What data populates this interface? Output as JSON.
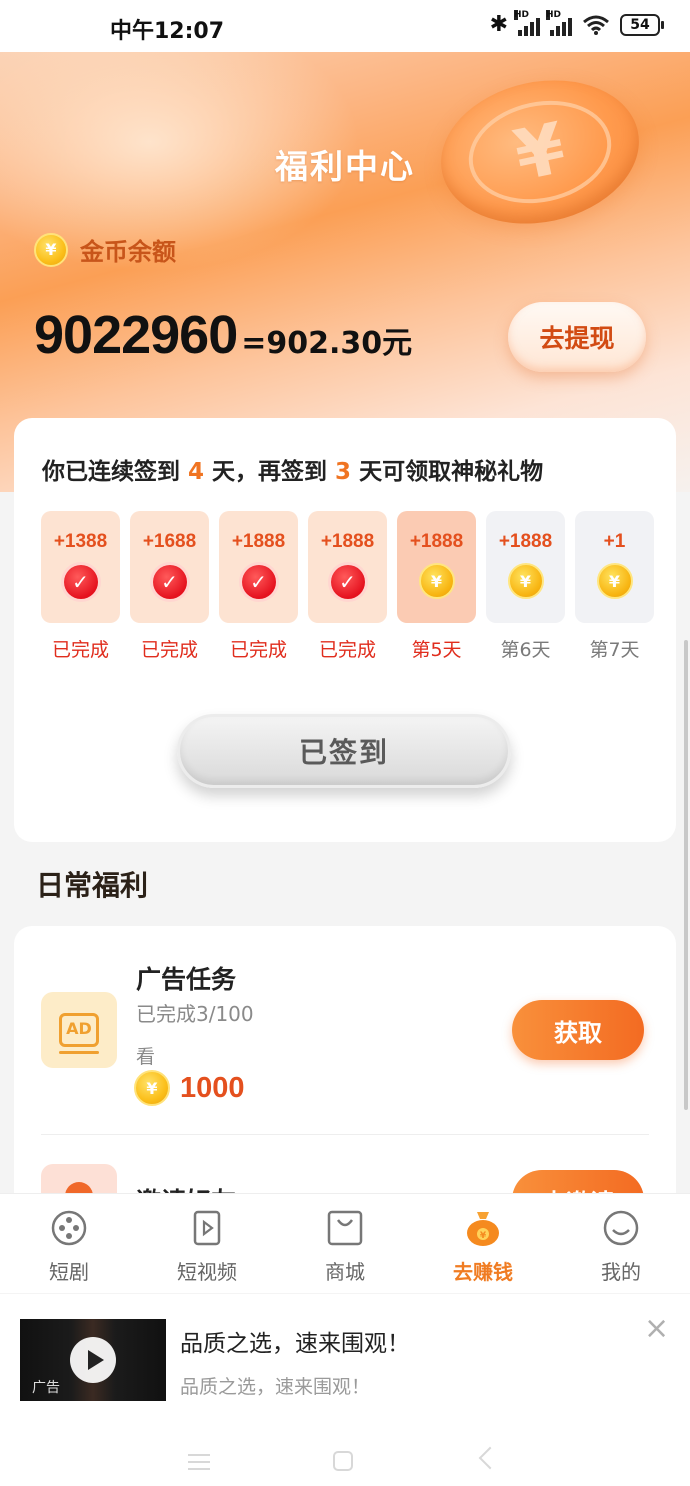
{
  "status_bar": {
    "time": "中午12:07",
    "battery": "54",
    "icons": [
      "bluetooth-icon",
      "signal-hd-icon",
      "signal-hd-icon",
      "wifi-icon",
      "battery-icon"
    ]
  },
  "header": {
    "title": "福利中心",
    "balance_label": "金币余额",
    "balance_coins": "9022960",
    "balance_yuan": "=902.30元",
    "withdraw_label": "去提现",
    "coin_symbol": "¥"
  },
  "sign_in": {
    "title_prefix": "你已连续签到 ",
    "streak_days": "4",
    "title_mid": " 天，再签到 ",
    "remaining_days": "3",
    "title_suffix": " 天可领取神秘礼物",
    "days": [
      {
        "value": "+1388",
        "label": "已完成",
        "state": "done"
      },
      {
        "value": "+1688",
        "label": "已完成",
        "state": "done"
      },
      {
        "value": "+1888",
        "label": "已完成",
        "state": "done"
      },
      {
        "value": "+1888",
        "label": "已完成",
        "state": "done"
      },
      {
        "value": "+1888",
        "label": "第5天",
        "state": "today"
      },
      {
        "value": "+1888",
        "label": "第6天",
        "state": "future"
      },
      {
        "value": "+1",
        "label": "第7天",
        "state": "future"
      }
    ],
    "button_label": "已签到"
  },
  "daily": {
    "section_title": "日常福利",
    "tasks": [
      {
        "name": "广告任务",
        "progress": "已完成3/100",
        "desc": "看",
        "reward": "1000",
        "button": "获取",
        "icon": "ad-icon"
      },
      {
        "name": "邀请好友",
        "button": "去邀请",
        "icon": "invite-icon"
      }
    ]
  },
  "tab_bar": {
    "tabs": [
      {
        "label": "短剧",
        "icon": "film-reel-icon"
      },
      {
        "label": "短视频",
        "icon": "video-play-icon"
      },
      {
        "label": "商城",
        "icon": "shopping-bag-icon"
      },
      {
        "label": "去赚钱",
        "icon": "money-bag-icon",
        "active": true
      },
      {
        "label": "我的",
        "icon": "smile-face-icon"
      }
    ]
  },
  "ad_banner": {
    "title": "品质之选，速来围观！",
    "subtitle": "品质之选，速来围观！",
    "tag": "广告"
  },
  "colors": {
    "accent": "#f07c22",
    "reward": "#e4501e",
    "done_label": "#e02d1d"
  }
}
